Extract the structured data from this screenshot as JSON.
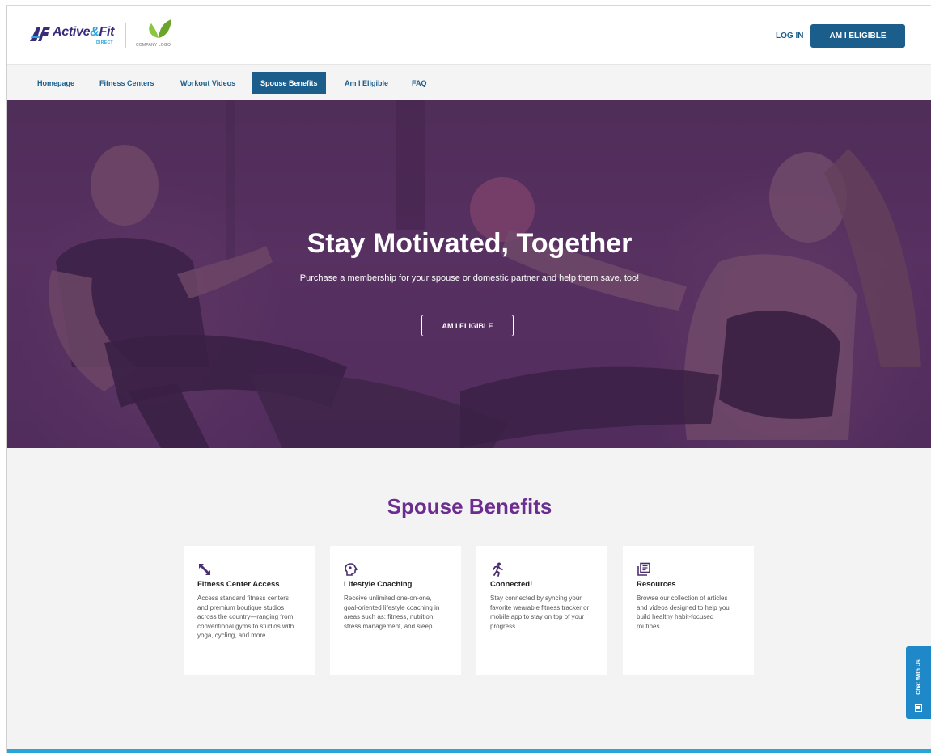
{
  "brand": {
    "logo_word_1": "Active",
    "logo_amp": "&",
    "logo_word_2": "Fit",
    "logo_sub": "DIRECT",
    "company_logo_label": "COMPANY LOGO"
  },
  "header": {
    "login_label": "LOG IN",
    "eligible_label": "AM I ELIGIBLE"
  },
  "nav": {
    "items": [
      {
        "label": "Homepage"
      },
      {
        "label": "Fitness Centers"
      },
      {
        "label": "Workout Videos"
      },
      {
        "label": "Spouse Benefits"
      },
      {
        "label": "Am I Eligible"
      },
      {
        "label": "FAQ"
      }
    ],
    "active": "Spouse Benefits"
  },
  "hero": {
    "title": "Stay Motivated, Together",
    "subtitle": "Purchase a membership for your spouse or domestic partner and help them save, too!",
    "button_label": "AM I ELIGIBLE"
  },
  "benefits": {
    "heading": "Spouse Benefits",
    "cards": [
      {
        "icon": "expand-arrows-icon",
        "title": "Fitness Center Access",
        "description": "Access standard fitness centers and premium boutique studios across the country—ranging from conventional gyms to studios with yoga, cycling, and more."
      },
      {
        "icon": "head-brain-icon",
        "title": "Lifestyle Coaching",
        "description": "Receive unlimited one-on-one, goal-oriented lifestyle coaching in areas such as: fitness, nutrition, stress management, and sleep."
      },
      {
        "icon": "running-person-icon",
        "title": "Connected!",
        "description": "Stay connected by syncing your favorite wearable fitness tracker or mobile app to stay on top of your progress."
      },
      {
        "icon": "library-books-icon",
        "title": "Resources",
        "description": "Browse our collection of articles and videos designed to help you build healthy habit-focused routines."
      }
    ]
  },
  "chat": {
    "label": "Chat With Us"
  },
  "colors": {
    "primary": "#1b5e8c",
    "accent_purple": "#6b2d8f",
    "hero_overlay": "#4f2f57",
    "chat_blue": "#1e88c8"
  }
}
